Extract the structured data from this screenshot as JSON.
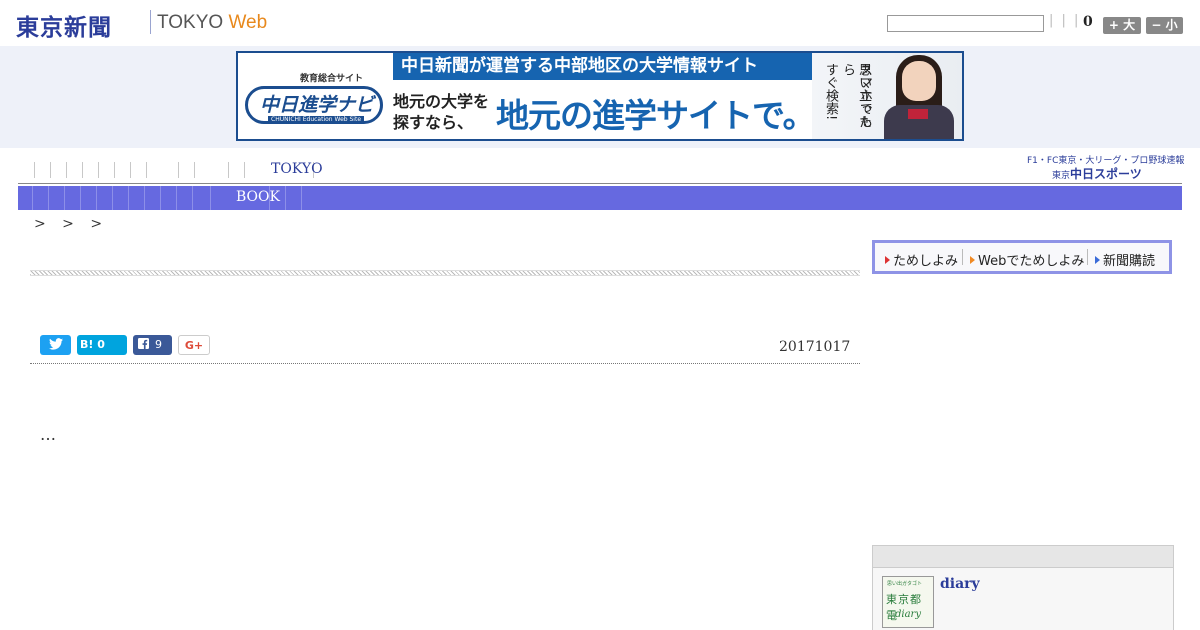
{
  "header": {
    "logo_jp": "東京新聞",
    "logo_en_prefix": "TOKYO ",
    "logo_en_web": "Web",
    "search_placeholder": "",
    "search_separators": "| | |",
    "count": "0",
    "font_big_label": "+ 大",
    "font_small_label": "− 小"
  },
  "ad": {
    "category": "教育総合サイト",
    "logo_name": "中日進学ナビ",
    "logo_sub": "CHUNICHI Education Web Site",
    "banner": "中日新聞が運営する中部地区の大学情報サイト",
    "left_line1": "地元の大学を",
    "left_line2": "探すなら、",
    "main": "地元の進学サイトで。",
    "vertical1": "スマホでも",
    "vertical2": "思い立ったら",
    "vertical3": "すぐ検索!"
  },
  "nav": {
    "primary_label": "TOKYO",
    "secondary_label": "BOOK",
    "chunichi_top": "F1・FC東京・大リーグ・プロ野球速報",
    "chunichi_small": "東京",
    "chunichi_name": "中日スポーツ"
  },
  "breadcrumb": ">  > >",
  "subscribe": {
    "items": [
      "ためしよみ",
      "Webでためしよみ",
      "新聞購読"
    ]
  },
  "article": {
    "share_tw": "",
    "share_hatena": "B! 0",
    "share_fb_count": "9",
    "share_gplus": "G+",
    "date": "20171017",
    "body": "…"
  },
  "sidebar": {
    "diary_img_l1": "思い出ガタゴト",
    "diary_img_l2": "東京都電",
    "diary_img_l3": "diary",
    "diary_title": "diary"
  },
  "colors": {
    "brand_blue": "#2b3d9a",
    "nav_bar": "#6669e0",
    "web_orange": "#e8891d"
  }
}
